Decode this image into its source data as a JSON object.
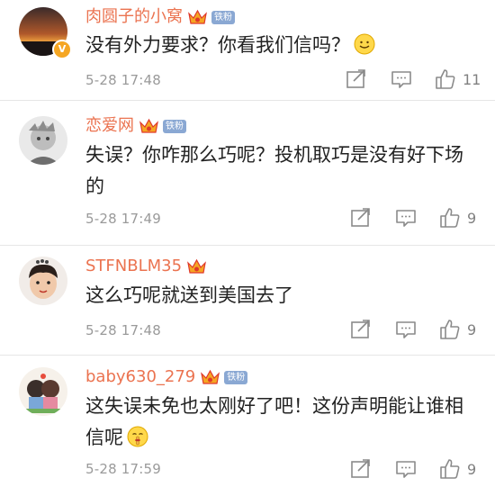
{
  "comments": [
    {
      "name": "肉圆子的小窝",
      "has_fan_badge": true,
      "fan_badge": "铁粉",
      "verified": true,
      "text": "没有外力要求？你看我们信吗？",
      "emoji": "smile-emoji",
      "time": "5-28 17:48",
      "likes": "11"
    },
    {
      "name": "恋爱网",
      "has_fan_badge": true,
      "fan_badge": "铁粉",
      "verified": false,
      "text": "失误？你咋那么巧呢？投机取巧是没有好下场的",
      "emoji": "",
      "time": "5-28 17:49",
      "likes": "9"
    },
    {
      "name": "STFNBLM35",
      "has_fan_badge": false,
      "fan_badge": "",
      "verified": false,
      "text": "这么巧呢就送到美国去了",
      "emoji": "",
      "time": "5-28 17:48",
      "likes": "9"
    },
    {
      "name": "baby630_279",
      "has_fan_badge": true,
      "fan_badge": "铁粉",
      "verified": false,
      "text": "这失误未免也太刚好了吧！这份声明能让谁相信呢",
      "emoji": "shush-emoji",
      "time": "5-28 17:59",
      "likes": "9"
    }
  ],
  "colors": {
    "name": "#eb7350",
    "text": "#222222",
    "meta": "#9a9a9a",
    "icon": "#8a8a8a",
    "fan_badge": "#8aa8d3",
    "crown": "#f5a623"
  },
  "icons": [
    "crown-icon",
    "verified-badge-icon",
    "repost-icon",
    "comment-icon",
    "like-icon"
  ]
}
